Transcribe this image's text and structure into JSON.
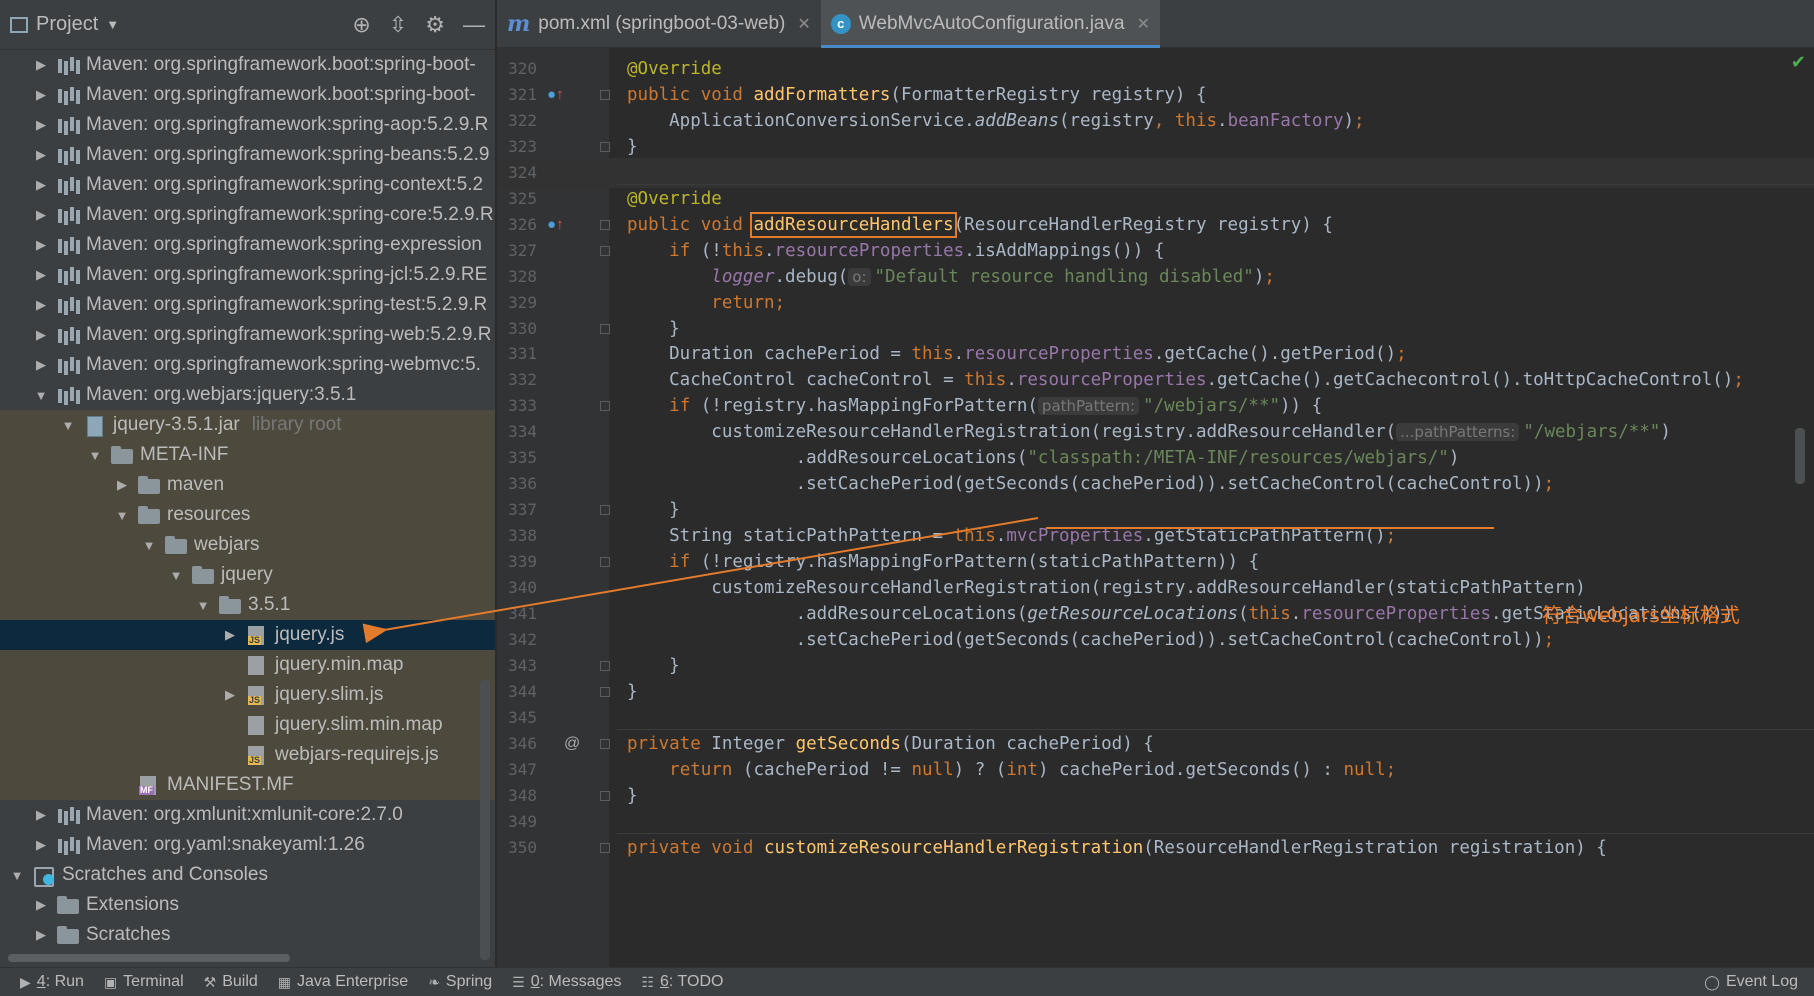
{
  "project_panel": {
    "title": "Project",
    "tree": [
      {
        "label": "Maven: org.springframework.boot:spring-boot-",
        "arrow": "▶",
        "icon": "lib",
        "indent": 0
      },
      {
        "label": "Maven: org.springframework.boot:spring-boot-",
        "arrow": "▶",
        "icon": "lib",
        "indent": 0
      },
      {
        "label": "Maven: org.springframework:spring-aop:5.2.9.R",
        "arrow": "▶",
        "icon": "lib",
        "indent": 0
      },
      {
        "label": "Maven: org.springframework:spring-beans:5.2.9",
        "arrow": "▶",
        "icon": "lib",
        "indent": 0
      },
      {
        "label": "Maven: org.springframework:spring-context:5.2",
        "arrow": "▶",
        "icon": "lib",
        "indent": 0
      },
      {
        "label": "Maven: org.springframework:spring-core:5.2.9.R",
        "arrow": "▶",
        "icon": "lib",
        "indent": 0
      },
      {
        "label": "Maven: org.springframework:spring-expression",
        "arrow": "▶",
        "icon": "lib",
        "indent": 0
      },
      {
        "label": "Maven: org.springframework:spring-jcl:5.2.9.RE",
        "arrow": "▶",
        "icon": "lib",
        "indent": 0
      },
      {
        "label": "Maven: org.springframework:spring-test:5.2.9.R",
        "arrow": "▶",
        "icon": "lib",
        "indent": 0
      },
      {
        "label": "Maven: org.springframework:spring-web:5.2.9.R",
        "arrow": "▶",
        "icon": "lib",
        "indent": 0
      },
      {
        "label": "Maven: org.springframework:spring-webmvc:5.",
        "arrow": "▶",
        "icon": "lib",
        "indent": 0
      },
      {
        "label": "Maven: org.webjars:jquery:3.5.1",
        "arrow": "▼",
        "icon": "lib",
        "indent": 0
      },
      {
        "label": "jquery-3.5.1.jar",
        "extra": "library root",
        "arrow": "▼",
        "icon": "jar",
        "indent": 1,
        "lib": true
      },
      {
        "label": "META-INF",
        "arrow": "▼",
        "icon": "folder",
        "indent": 2,
        "lib": true
      },
      {
        "label": "maven",
        "arrow": "▶",
        "icon": "folder",
        "indent": 3,
        "lib": true
      },
      {
        "label": "resources",
        "arrow": "▼",
        "icon": "folder",
        "indent": 3,
        "lib": true
      },
      {
        "label": "webjars",
        "arrow": "▼",
        "icon": "folder",
        "indent": 4,
        "lib": true
      },
      {
        "label": "jquery",
        "arrow": "▼",
        "icon": "folder",
        "indent": 5,
        "lib": true
      },
      {
        "label": "3.5.1",
        "arrow": "▼",
        "icon": "folder",
        "indent": 6,
        "lib": true
      },
      {
        "label": "jquery.js",
        "arrow": "▶",
        "icon": "js",
        "indent": 7,
        "selected": true
      },
      {
        "label": "jquery.min.map",
        "arrow": "",
        "icon": "map",
        "indent": 7,
        "lib": true
      },
      {
        "label": "jquery.slim.js",
        "arrow": "▶",
        "icon": "js",
        "indent": 7,
        "lib": true
      },
      {
        "label": "jquery.slim.min.map",
        "arrow": "",
        "icon": "map",
        "indent": 7,
        "lib": true
      },
      {
        "label": "webjars-requirejs.js",
        "arrow": "",
        "icon": "js",
        "indent": 7,
        "lib": true
      },
      {
        "label": "MANIFEST.MF",
        "arrow": "",
        "icon": "mf",
        "indent": 3,
        "lib": true
      },
      {
        "label": "Maven: org.xmlunit:xmlunit-core:2.7.0",
        "arrow": "▶",
        "icon": "lib",
        "indent": 0
      },
      {
        "label": "Maven: org.yaml:snakeyaml:1.26",
        "arrow": "▶",
        "icon": "lib",
        "indent": 0
      },
      {
        "label": "Scratches and Consoles",
        "arrow": "▼",
        "icon": "scratch",
        "indent": -1
      },
      {
        "label": "Extensions",
        "arrow": "▶",
        "icon": "folder",
        "indent": 0
      },
      {
        "label": "Scratches",
        "arrow": "▶",
        "icon": "folder",
        "indent": 0
      }
    ]
  },
  "tabs": [
    {
      "label": "pom.xml (springboot-03-web)",
      "icon": "m",
      "active": false
    },
    {
      "label": "WebMvcAutoConfiguration.java",
      "icon": "c",
      "active": true
    }
  ],
  "code_lines": [
    {
      "n": "320",
      "html": "<span class=\"an\">@Override</span>"
    },
    {
      "n": "321",
      "html": "<span class=\"k\">public void </span><span class=\"fn\">addFormatters</span>(FormatterRegistry registry) {",
      "marker": "o↑"
    },
    {
      "n": "322",
      "html": "    ApplicationConversionService.<span class=\"it\">addBeans</span>(registry<span class=\"pu\">, </span><span class=\"k\">this</span>.<span class=\"fld\">beanFactory</span>)<span class=\"pu\">;</span>"
    },
    {
      "n": "323",
      "html": "}"
    },
    {
      "n": "324",
      "html": ""
    },
    {
      "n": "325",
      "html": "<span class=\"an\">@Override</span>"
    },
    {
      "n": "326",
      "html": "<span class=\"k\">public void </span><span class=\"fn box\">addResourceHandlers</span>(ResourceHandlerRegistry registry) {",
      "marker": "o↑"
    },
    {
      "n": "327",
      "html": "    <span class=\"k\">if </span>(!<span class=\"k\">this</span>.<span class=\"fld\">resourceProperties</span>.isAddMappings()) {"
    },
    {
      "n": "328",
      "html": "        <span class=\"fld it\">logger</span>.debug(<span class=\"hint\">o:</span><span class=\"st\">\"Default resource handling disabled\"</span>)<span class=\"pu\">;</span>"
    },
    {
      "n": "329",
      "html": "        <span class=\"k\">return;</span>"
    },
    {
      "n": "330",
      "html": "    }"
    },
    {
      "n": "331",
      "html": "    Duration cachePeriod = <span class=\"k\">this</span>.<span class=\"fld\">resourceProperties</span>.getCache().getPeriod()<span class=\"pu\">;</span>"
    },
    {
      "n": "332",
      "html": "    CacheControl cacheControl = <span class=\"k\">this</span>.<span class=\"fld\">resourceProperties</span>.getCache().getCachecontrol().toHttpCacheControl()<span class=\"pu\">;</span>"
    },
    {
      "n": "333",
      "html": "    <span class=\"k\">if </span>(!registry.hasMappingForPattern(<span class=\"hint\">pathPattern:</span><span class=\"st\">\"/webjars/**\"</span>)) {"
    },
    {
      "n": "334",
      "html": "        customizeResourceHandlerRegistration(registry.addResourceHandler(<span class=\"hint\">...pathPatterns:</span><span class=\"st\">\"/webjars/**\"</span>)"
    },
    {
      "n": "335",
      "html": "                .addResourceLocations(<span class=\"st\">\"classpath:/META-INF/resources/webjars/\"</span>)"
    },
    {
      "n": "336",
      "html": "                .setCachePeriod(getSeconds(cachePeriod)).setCacheControl(cacheControl))<span class=\"pu\">;</span>"
    },
    {
      "n": "337",
      "html": "    }"
    },
    {
      "n": "338",
      "html": "    String staticPathPattern = <span class=\"k\">this</span>.<span class=\"fld\">mvcProperties</span>.getStaticPathPattern()<span class=\"pu\">;</span>"
    },
    {
      "n": "339",
      "html": "    <span class=\"k\">if </span>(!registry.hasMappingForPattern(staticPathPattern)) {"
    },
    {
      "n": "340",
      "html": "        customizeResourceHandlerRegistration(registry.addResourceHandler(staticPathPattern)"
    },
    {
      "n": "341",
      "html": "                .addResourceLocations(<span class=\"it\">getResourceLocations</span>(<span class=\"k\">this</span>.<span class=\"fld\">resourceProperties</span>.getStaticLocations()))"
    },
    {
      "n": "342",
      "html": "                .setCachePeriod(getSeconds(cachePeriod)).setCacheControl(cacheControl))<span class=\"pu\">;</span>"
    },
    {
      "n": "343",
      "html": "    }"
    },
    {
      "n": "344",
      "html": "}"
    },
    {
      "n": "345",
      "html": ""
    },
    {
      "n": "346",
      "html": "<span class=\"k\">private </span>Integer <span class=\"fn\">getSeconds</span>(Duration cachePeriod) {",
      "marker": "@"
    },
    {
      "n": "347",
      "html": "    <span class=\"k\">return </span>(cachePeriod != <span class=\"k\">null</span>) ? (<span class=\"k\">int</span>) cachePeriod.getSeconds() : <span class=\"k\">null;</span>"
    },
    {
      "n": "348",
      "html": "}"
    },
    {
      "n": "349",
      "html": ""
    },
    {
      "n": "350",
      "html": "<span class=\"k\">private void </span><span class=\"fn\">customizeResourceHandlerRegistration</span>(ResourceHandlerRegistration registration) {"
    }
  ],
  "annotation_text": "符合webjars坐标格式",
  "status_bar": [
    {
      "key": "4",
      "label": ": Run",
      "icon": "▶"
    },
    {
      "key": "",
      "label": "Terminal",
      "icon": "▣"
    },
    {
      "key": "",
      "label": "Build",
      "icon": "⚒"
    },
    {
      "key": "",
      "label": "Java Enterprise",
      "icon": "▦"
    },
    {
      "key": "",
      "label": "Spring",
      "icon": "❧"
    },
    {
      "key": "0",
      "label": ": Messages",
      "icon": "☰"
    },
    {
      "key": "6",
      "label": ": TODO",
      "icon": "☷"
    }
  ],
  "event_log": "Event Log",
  "colors": {
    "accent": "#4a88c7",
    "annotation": "#e37b2d",
    "selection": "#0d293e",
    "library_bg": "#4d4a3d"
  }
}
